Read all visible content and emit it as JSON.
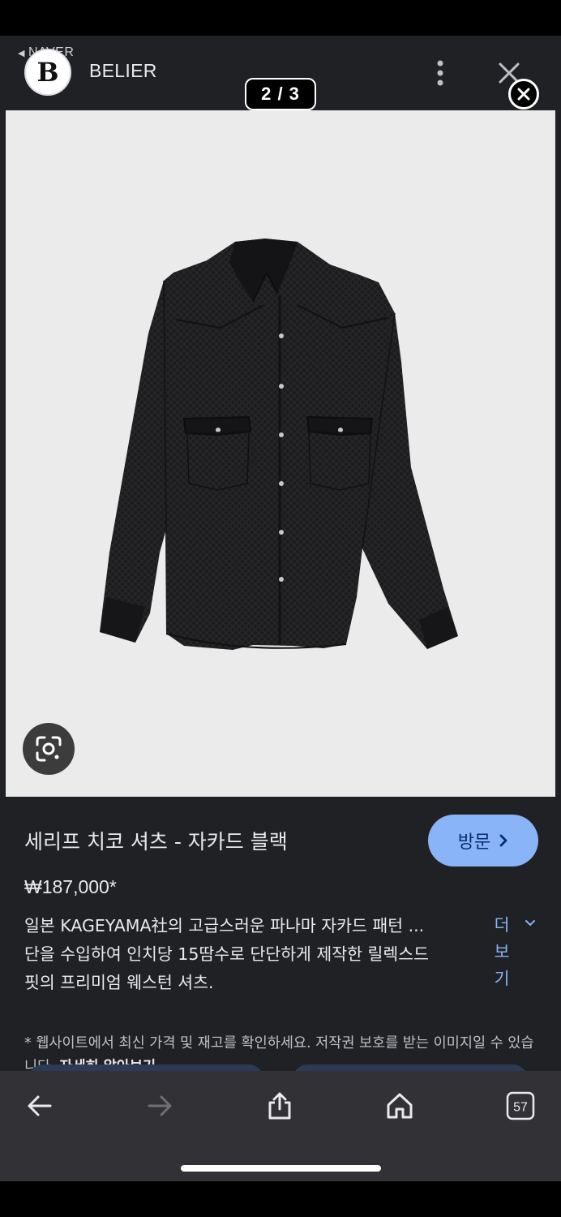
{
  "header": {
    "back_app_label": "NAVER",
    "logo_letter": "B",
    "site_name": "BELIER",
    "image_counter": "2 / 3"
  },
  "product": {
    "title": "세리프 치코 셔츠 - 자카드 블랙",
    "visit_label": "방문",
    "price": "₩187,000*",
    "description_lines": [
      "일본 KAGEYAMA社의 고급스러운 파나마 자카드 패턴 ...",
      "단을 수입하여 인치당 15땀수로 단단하게 제작한 릴렉스드",
      "핏의 프리미엄 웨스턴 셔츠."
    ],
    "more_label": [
      "더",
      "보",
      "기"
    ],
    "notice": "* 웹사이트에서 최신 가격 및 재고를 확인하세요. 저작권 보호를 받는 이미지일 수 있습니다.",
    "notice_link": "자세히 알아보기"
  },
  "toolbar": {
    "tab_count": "57"
  },
  "icons": {
    "back": "arrow-left-icon",
    "forward": "arrow-right-icon",
    "share": "share-icon",
    "home": "home-icon",
    "tabs": "tabs-icon",
    "lens": "lens-icon",
    "more": "more-vertical-icon",
    "close": "close-icon"
  },
  "colors": {
    "background": "#202124",
    "accent": "#8ab4f8",
    "toolbar": "#323236"
  }
}
